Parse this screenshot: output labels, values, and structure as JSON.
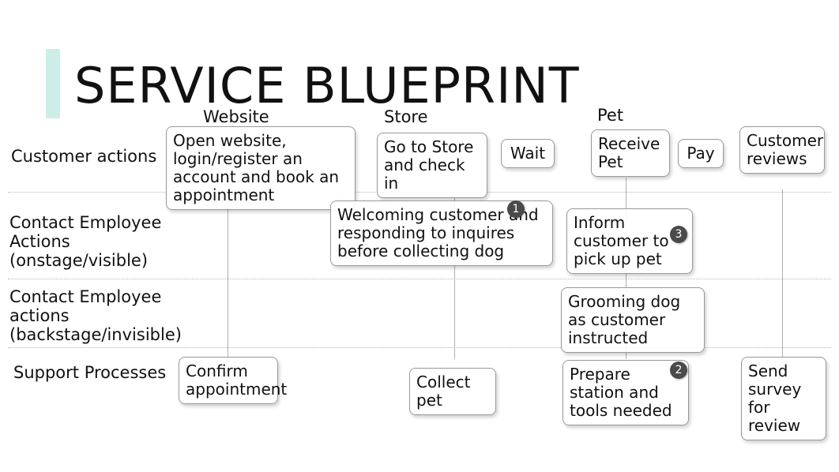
{
  "title": "SERVICE BLUEPRINT",
  "columns": {
    "website": "Website",
    "store": "Store",
    "pet": "Pet"
  },
  "rows": {
    "customer": "Customer actions",
    "onstage": "Contact Employee Actions (onstage/visible)",
    "backstage": "Contact Employee actions (backstage/invisible)",
    "support": "Support Processes"
  },
  "boxes": {
    "open_website": "Open website, login/register an account and book an appointment",
    "go_store": "Go to Store and check in",
    "wait": "Wait",
    "receive_pet": "Receive Pet",
    "pay": "Pay",
    "reviews": "Customer reviews",
    "welcoming": "Welcoming customer and responding to inquires before collecting dog",
    "inform": "Inform customer to pick up pet",
    "grooming": "Grooming dog as customer instructed",
    "confirm": "Confirm appointment",
    "collect": "Collect pet",
    "prepare": "Prepare station and tools needed",
    "survey": "Send survey for review"
  },
  "badges": {
    "b1": "1",
    "b2": "2",
    "b3": "3"
  }
}
